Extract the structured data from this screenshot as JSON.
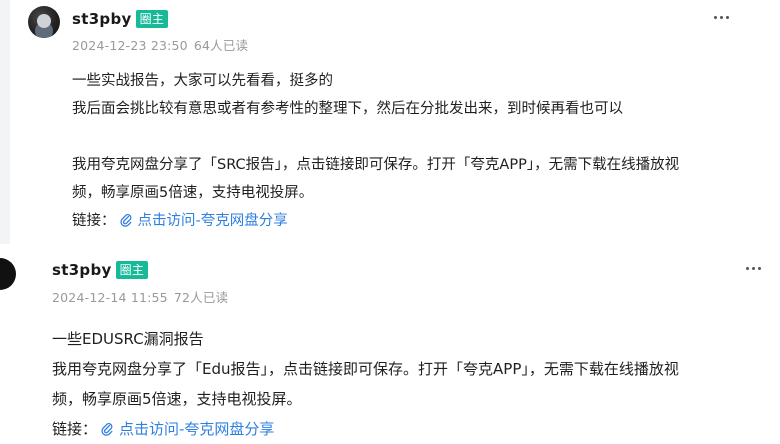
{
  "posts": [
    {
      "author": "st3pby",
      "badge": "圈主",
      "datetime": "2024-12-23 23:50",
      "readers": "64人已读",
      "lines": [
        "一些实战报告，大家可以先看看，挺多的",
        "我后面会挑比较有意思或者有参考性的整理下，然后在分批发出来，到时候再看也可以"
      ],
      "share_lines": [
        "我用夸克网盘分享了「SRC报告」，点击链接即可保存。打开「夸克APP」，无需下载在线播放视",
        "频，畅享原画5倍速，支持电视投屏。"
      ],
      "link_label": "链接：",
      "link_text": "点击访问-夸克网盘分享"
    },
    {
      "author": "st3pby",
      "badge": "圈主",
      "datetime": "2024-12-14 11:55",
      "readers": "72人已读",
      "lines": [
        "一些EDUSRC漏洞报告"
      ],
      "share_lines": [
        "我用夸克网盘分享了「Edu报告」，点击链接即可保存。打开「夸克APP」，无需下载在线播放视",
        "频，畅享原画5倍速，支持电视投屏。"
      ],
      "link_label": "链接：",
      "link_text": "点击访问-夸克网盘分享"
    }
  ],
  "icons": {
    "more": "more-dots-icon",
    "link": "paperclip-icon"
  },
  "colors": {
    "badge": "#16b998",
    "link": "#2f7fe0",
    "meta": "#9a9a9a"
  }
}
